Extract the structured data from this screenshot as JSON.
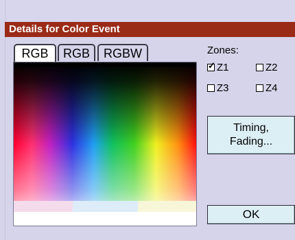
{
  "dialog": {
    "title": "Details for Color Event"
  },
  "tabs": [
    {
      "label": "RGB",
      "active": true
    },
    {
      "label": "RGB",
      "active": false
    },
    {
      "label": "RGBW",
      "active": false
    }
  ],
  "zones": {
    "label": "Zones:",
    "items": [
      {
        "label": "Z1",
        "checked": true
      },
      {
        "label": "Z2",
        "checked": false
      },
      {
        "label": "Z3",
        "checked": false
      },
      {
        "label": "Z4",
        "checked": false
      }
    ]
  },
  "buttons": {
    "timing_line1": "Timing,",
    "timing_line2": "Fading...",
    "ok": "OK"
  },
  "colors": {
    "title_bar": "#9a2b17",
    "background": "#d6d4ea",
    "button_face": "#dceff5"
  },
  "check_mark": "✓"
}
